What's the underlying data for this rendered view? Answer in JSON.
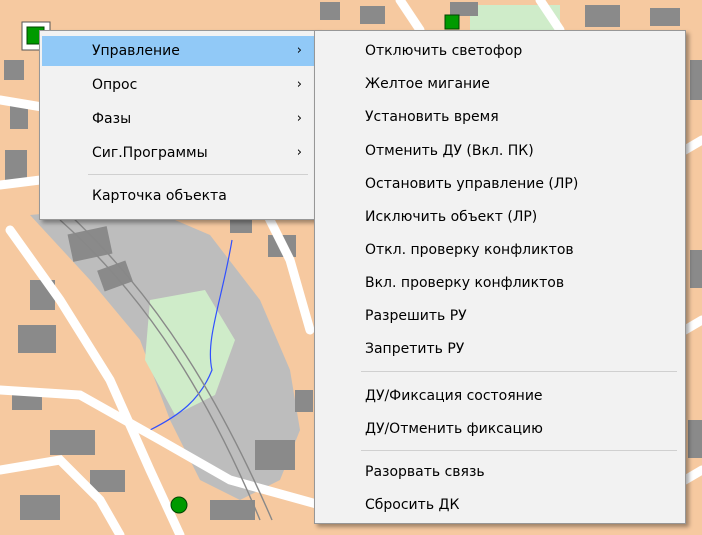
{
  "main_menu": {
    "items": [
      {
        "label": "Управление",
        "arrow": "›"
      },
      {
        "label": "Опрос",
        "arrow": "›"
      },
      {
        "label": "Фазы",
        "arrow": "›"
      },
      {
        "label": "Сиг.Программы",
        "arrow": "›"
      },
      {
        "label": "Карточка объекта"
      }
    ]
  },
  "submenu": {
    "items": [
      {
        "label": "Отключить светофор"
      },
      {
        "label": "Желтое мигание"
      },
      {
        "label": "Установить время"
      },
      {
        "label": "Отменить ДУ (Вкл. ПК)"
      },
      {
        "label": "Остановить управление (ЛР)"
      },
      {
        "label": "Исключить объект (ЛР)"
      },
      {
        "label": "Откл. проверку конфликтов"
      },
      {
        "label": "Вкл. проверку конфликтов"
      },
      {
        "label": "Разрешить РУ"
      },
      {
        "label": "Запретить РУ"
      },
      {
        "label": "ДУ/Фиксация состояние"
      },
      {
        "label": "ДУ/Отменить фиксацию"
      },
      {
        "label": "Разорвать связь"
      },
      {
        "label": "Сбросить ДК"
      }
    ]
  },
  "colors": {
    "map_block": "#f6c9a0",
    "road": "#ffffff",
    "building": "#8a8a8a",
    "railway_area": "#bdbdbd",
    "park": "#cfecc9",
    "stream": "#3050ff",
    "marker_green": "#009a00",
    "menu_bg": "#f2f2f2",
    "highlight": "#91c9f7"
  },
  "icons": {
    "traffic_light_marker": "green-square-marker",
    "detector_marker": "green-circle-marker"
  }
}
